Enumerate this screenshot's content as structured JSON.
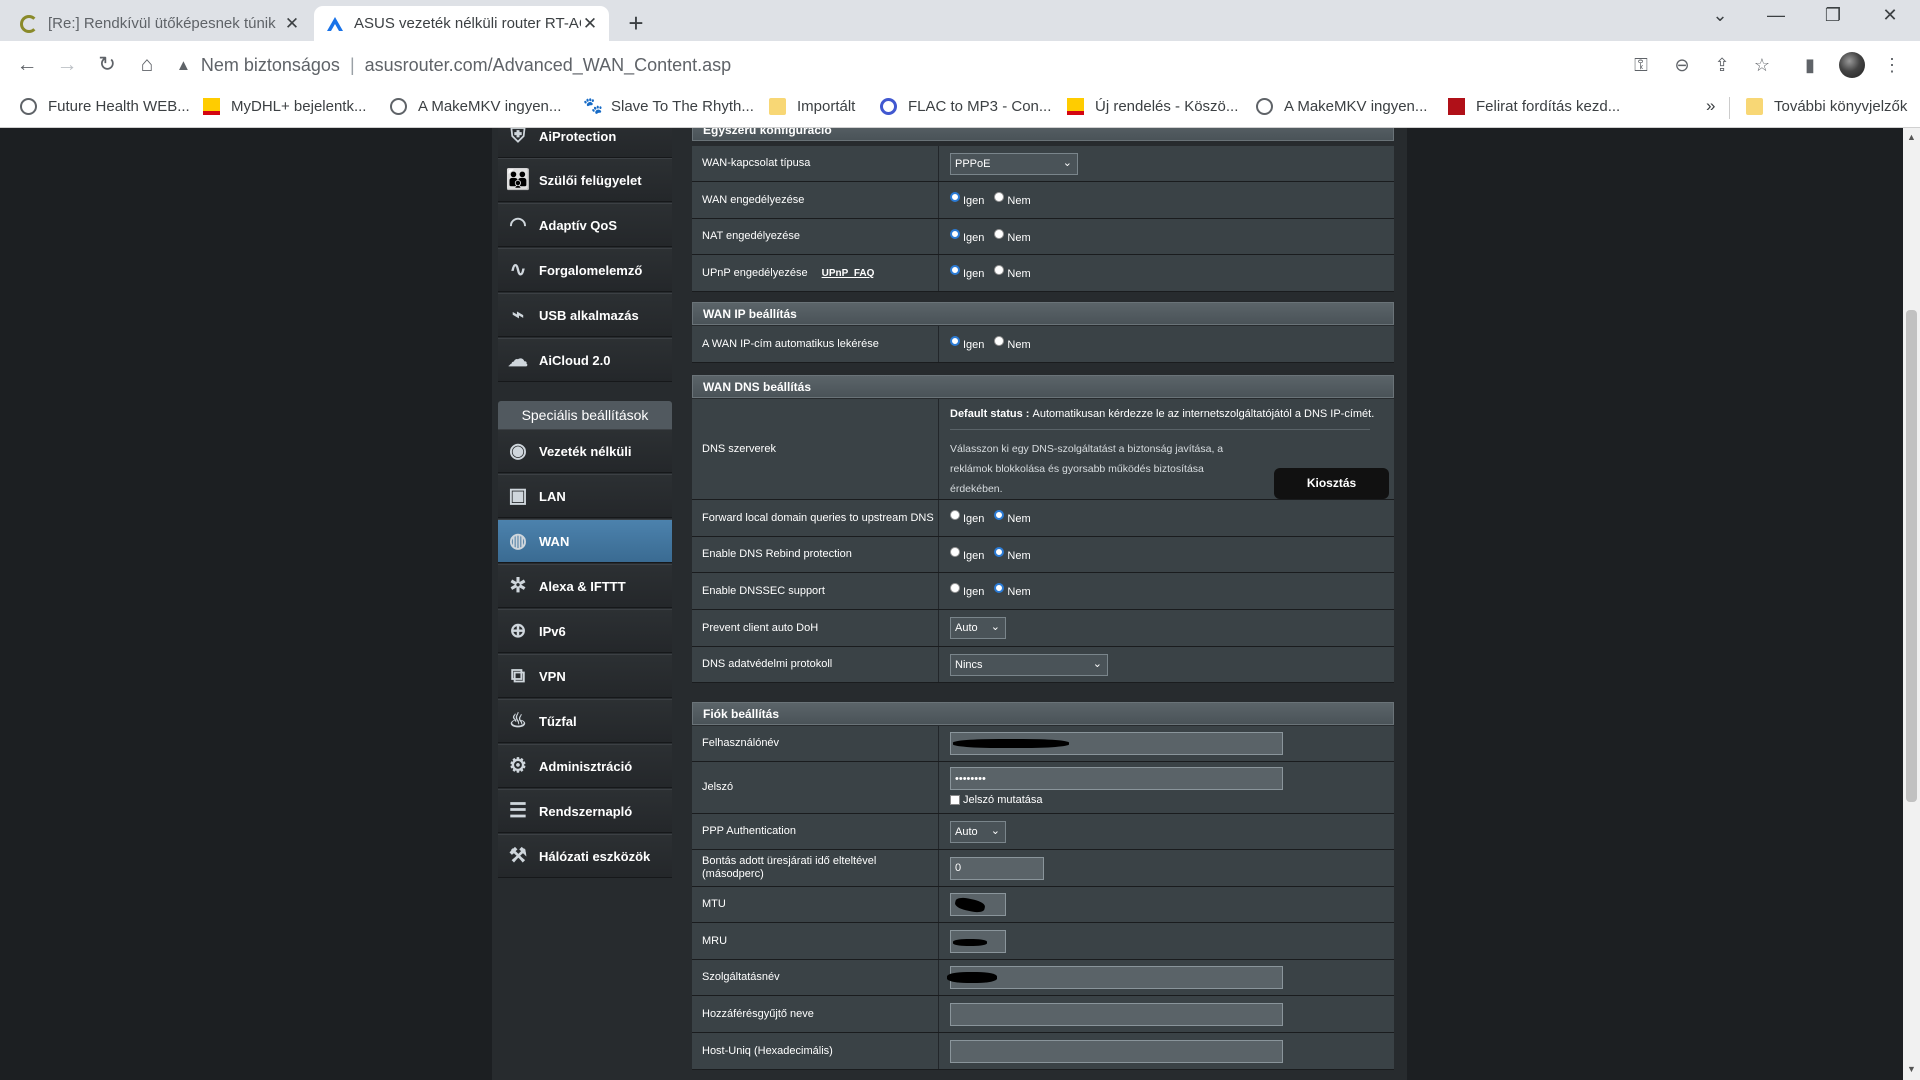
{
  "browser": {
    "tabs": [
      {
        "title": "[Re:] Rendkívül ütőképesnek túnik",
        "active": false
      },
      {
        "title": "ASUS vezeték nélküli router RT-AC",
        "active": true
      }
    ],
    "address": {
      "security_label": "Nem biztonságos",
      "url": "asusrouter.com/Advanced_WAN_Content.asp"
    },
    "bookmarks": [
      {
        "label": "Future Health WEB...",
        "icon": "globe-icon"
      },
      {
        "label": "MyDHL+ bejelentk...",
        "icon": "dhl-icon"
      },
      {
        "label": "A MakeMKV ingyen...",
        "icon": "globe-icon"
      },
      {
        "label": "Slave To The Rhyth...",
        "icon": "paw-icon"
      },
      {
        "label": "Importált",
        "icon": "folder-icon"
      },
      {
        "label": "FLAC to MP3 - Con...",
        "icon": "flac-icon"
      },
      {
        "label": "Új rendelés - Köszö...",
        "icon": "dhl-icon"
      },
      {
        "label": "A MakeMKV ingyen...",
        "icon": "globe-icon"
      },
      {
        "label": "Felirat fordítás kezd...",
        "icon": "felirat-icon"
      }
    ],
    "more_bookmarks_label": "További könyvjelzők"
  },
  "sidebar": {
    "general_items": [
      {
        "label": "AiProtection",
        "icon": "shield-icon"
      },
      {
        "label": "Szülői felügyelet",
        "icon": "family-icon"
      },
      {
        "label": "Adaptív QoS",
        "icon": "gauge-icon"
      },
      {
        "label": "Forgalomelemző",
        "icon": "traffic-icon"
      },
      {
        "label": "USB alkalmazás",
        "icon": "usb-icon"
      },
      {
        "label": "AiCloud 2.0",
        "icon": "cloud-icon"
      }
    ],
    "advanced_header": "Speciális beállítások",
    "advanced_items": [
      {
        "label": "Vezeték nélküli",
        "icon": "wifi-icon",
        "active": false
      },
      {
        "label": "LAN",
        "icon": "lan-icon",
        "active": false
      },
      {
        "label": "WAN",
        "icon": "globe-icon",
        "active": true
      },
      {
        "label": "Alexa & IFTTT",
        "icon": "alexa-icon",
        "active": false
      },
      {
        "label": "IPv6",
        "icon": "ipv6-icon",
        "active": false
      },
      {
        "label": "VPN",
        "icon": "vpn-icon",
        "active": false
      },
      {
        "label": "Tűzfal",
        "icon": "fire-icon",
        "active": false
      },
      {
        "label": "Adminisztráció",
        "icon": "gear-icon",
        "active": false
      },
      {
        "label": "Rendszernapló",
        "icon": "log-icon",
        "active": false
      },
      {
        "label": "Hálózati eszközök",
        "icon": "tools-icon",
        "active": false
      }
    ]
  },
  "panel": {
    "sections": {
      "basic": "Egyszerű konfiguráció",
      "wan_ip": "WAN IP beállítás",
      "wan_dns": "WAN DNS beállítás",
      "account": "Fiók beállítás"
    },
    "radio": {
      "yes": "Igen",
      "no": "Nem"
    },
    "basic": {
      "wan_type_label": "WAN-kapcsolat típusa",
      "wan_type_value": "PPPoE",
      "wan_enable_label": "WAN engedélyezése",
      "nat_enable_label": "NAT engedélyezése",
      "upnp_enable_label": "UPnP engedélyezése",
      "upnp_faq": "UPnP_FAQ"
    },
    "wan_ip": {
      "auto_ip_label": "A WAN IP-cím automatikus lekérése"
    },
    "wan_dns": {
      "dns_servers_label": "DNS szerverek",
      "default_status_prefix": "Default status : ",
      "default_status_text": "Automatikusan kérdezze le az internetszolgáltatójától a DNS IP-címét.",
      "dns_hint": "Válasszon ki egy DNS-szolgáltatást a biztonság javítása, a reklámok blokkolása és gyorsabb működés biztosítása érdekében.",
      "assign_button": "Kiosztás",
      "forward_label": "Forward local domain queries to upstream DNS",
      "rebind_label": "Enable DNS Rebind protection",
      "dnssec_label": "Enable DNSSEC support",
      "doh_label": "Prevent client auto DoH",
      "doh_value": "Auto",
      "privacy_label": "DNS adatvédelmi protokoll",
      "privacy_value": "Nincs"
    },
    "account": {
      "username_label": "Felhasználónév",
      "password_label": "Jelszó",
      "password_value": "••••••••",
      "show_password_label": "Jelszó mutatása",
      "ppp_auth_label": "PPP Authentication",
      "ppp_auth_value": "Auto",
      "idle_label": "Bontás adott üresjárati idő elteltével (másodperc)",
      "idle_value": "0",
      "mtu_label": "MTU",
      "mru_label": "MRU",
      "service_label": "Szolgáltatásnév",
      "ac_label": "Hozzáférésgyűjtő neve",
      "hostuniq_label": "Host-Uniq (Hexadecimális)"
    }
  }
}
